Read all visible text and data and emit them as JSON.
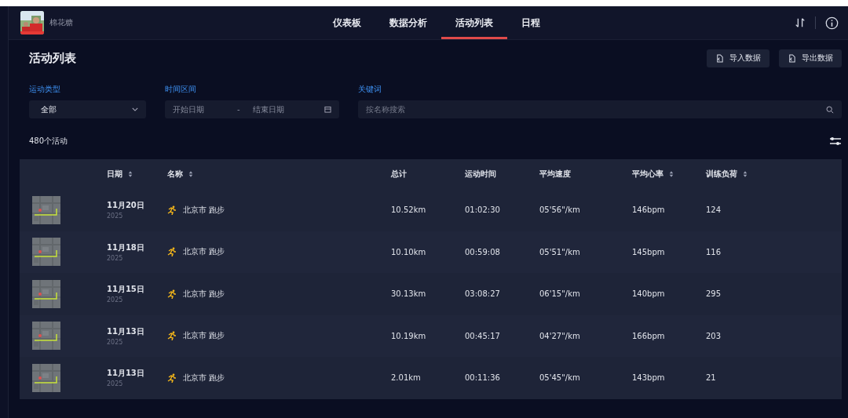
{
  "nav": {
    "user": "棉花糖",
    "tabs": [
      {
        "label": "仪表板",
        "selected": false
      },
      {
        "label": "数据分析",
        "selected": false
      },
      {
        "label": "活动列表",
        "selected": true
      },
      {
        "label": "日程",
        "selected": false
      }
    ]
  },
  "page": {
    "title": "活动列表",
    "buttons": [
      "导入数据",
      "导出数据"
    ]
  },
  "filters": {
    "sport_type": {
      "label": "运动类型",
      "value": "全部"
    },
    "time_range": {
      "label": "时间区间",
      "start_placeholder": "开始日期",
      "separator": "-",
      "end_placeholder": "结束日期"
    },
    "keyword": {
      "label": "关键词",
      "placeholder": "按名称搜索"
    }
  },
  "count": "480个活动",
  "table": {
    "columns": [
      {
        "label": "日期",
        "sortable": true
      },
      {
        "label": "名称",
        "sortable": true
      },
      {
        "label": "总计",
        "sortable": false
      },
      {
        "label": "运动时间",
        "sortable": false
      },
      {
        "label": "平均速度",
        "sortable": false
      },
      {
        "label": "平均心率",
        "sortable": true
      },
      {
        "label": "训练负荷",
        "sortable": true
      }
    ],
    "rows": [
      {
        "date": "11月20日",
        "year": "2025",
        "name": "北京市 跑步",
        "total": "10.52km",
        "time": "01:02:30",
        "pace": "05'56\"/km",
        "heart_rate": "146bpm",
        "load": "124"
      },
      {
        "date": "11月18日",
        "year": "2025",
        "name": "北京市 跑步",
        "total": "10.10km",
        "time": "00:59:08",
        "pace": "05'51\"/km",
        "heart_rate": "145bpm",
        "load": "116"
      },
      {
        "date": "11月15日",
        "year": "2025",
        "name": "北京市 跑步",
        "total": "30.13km",
        "time": "03:08:27",
        "pace": "06'15\"/km",
        "heart_rate": "140bpm",
        "load": "295"
      },
      {
        "date": "11月13日",
        "year": "2025",
        "name": "北京市 跑步",
        "total": "10.19km",
        "time": "00:45:17",
        "pace": "04'27\"/km",
        "heart_rate": "166bpm",
        "load": "203"
      },
      {
        "date": "11月13日",
        "year": "2025",
        "name": "北京市 跑步",
        "total": "2.01km",
        "time": "00:11:36",
        "pace": "05'45\"/km",
        "heart_rate": "143bpm",
        "load": "21"
      }
    ]
  }
}
